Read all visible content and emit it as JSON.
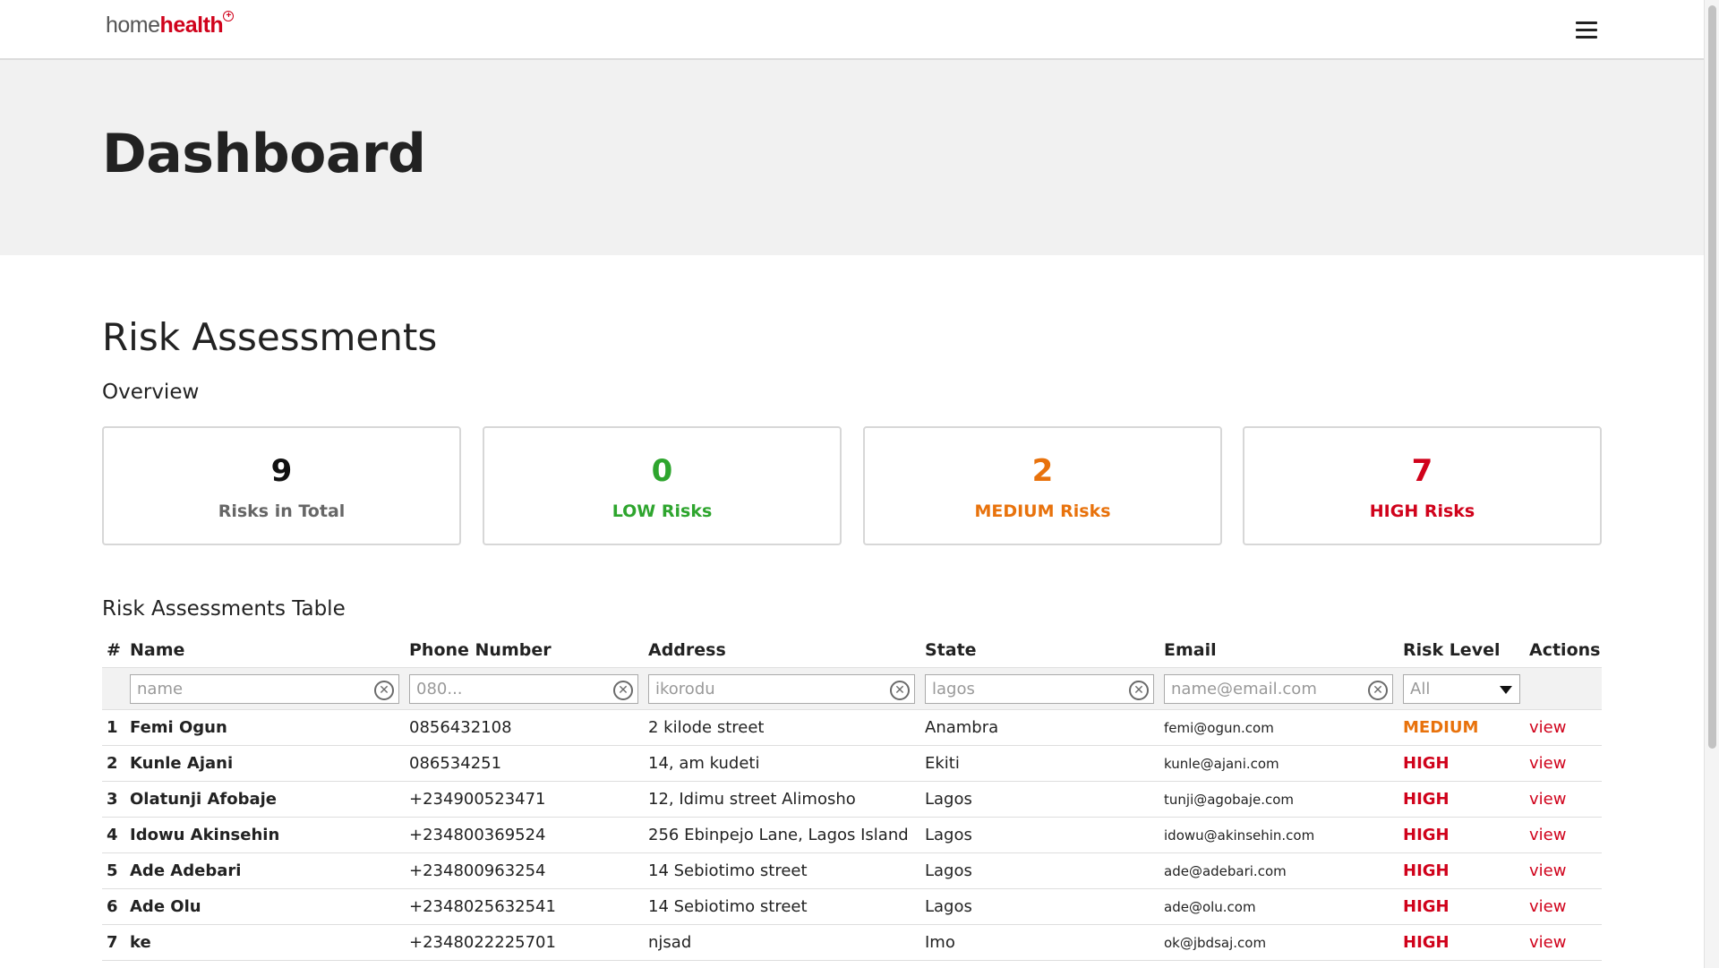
{
  "brand": {
    "home": "home",
    "health": "health",
    "accent": "#d0021b"
  },
  "hero": {
    "title": "Dashboard"
  },
  "section": {
    "title": "Risk Assessments",
    "overview_label": "Overview",
    "table_title": "Risk Assessments Table"
  },
  "cards": [
    {
      "value": "9",
      "label": "Risks in Total",
      "color": "#111111",
      "label_color": "#666666"
    },
    {
      "value": "0",
      "label": "LOW Risks",
      "color": "#2ea52e",
      "label_color": "#2ea52e"
    },
    {
      "value": "2",
      "label": "MEDIUM Risks",
      "color": "#e8720c",
      "label_color": "#e8720c"
    },
    {
      "value": "7",
      "label": "HIGH Risks",
      "color": "#d0021b",
      "label_color": "#d0021b"
    }
  ],
  "table": {
    "headers": {
      "index": "#",
      "name": "Name",
      "phone": "Phone Number",
      "address": "Address",
      "state": "State",
      "email": "Email",
      "risk": "Risk Level",
      "actions": "Actions"
    },
    "filters": {
      "name": "name",
      "phone": "080...",
      "address": "ikorodu",
      "state": "lagos",
      "email": "name@email.com",
      "risk": "All"
    },
    "rows": [
      {
        "index": "1",
        "name": "Femi Ogun",
        "phone": "0856432108",
        "address": "2 kilode street",
        "state": "Anambra",
        "email": "femi@ogun.com",
        "risk": "MEDIUM",
        "action": "view"
      },
      {
        "index": "2",
        "name": "Kunle Ajani",
        "phone": "086534251",
        "address": "14, am kudeti",
        "state": "Ekiti",
        "email": "kunle@ajani.com",
        "risk": "HIGH",
        "action": "view"
      },
      {
        "index": "3",
        "name": "Olatunji Afobaje",
        "phone": "+234900523471",
        "address": "12, Idimu street Alimosho",
        "state": "Lagos",
        "email": "tunji@agobaje.com",
        "risk": "HIGH",
        "action": "view"
      },
      {
        "index": "4",
        "name": "Idowu Akinsehin",
        "phone": "+234800369524",
        "address": "256 Ebinpejo Lane, Lagos Island",
        "state": "Lagos",
        "email": "idowu@akinsehin.com",
        "risk": "HIGH",
        "action": "view"
      },
      {
        "index": "5",
        "name": "Ade Adebari",
        "phone": "+234800963254",
        "address": "14 Sebiotimo street",
        "state": "Lagos",
        "email": "ade@adebari.com",
        "risk": "HIGH",
        "action": "view"
      },
      {
        "index": "6",
        "name": "Ade Olu",
        "phone": "+2348025632541",
        "address": "14 Sebiotimo street",
        "state": "Lagos",
        "email": "ade@olu.com",
        "risk": "HIGH",
        "action": "view"
      },
      {
        "index": "7",
        "name": "ke",
        "phone": "+2348022225701",
        "address": "njsad",
        "state": "Imo",
        "email": "ok@jbdsaj.com",
        "risk": "HIGH",
        "action": "view"
      }
    ]
  }
}
